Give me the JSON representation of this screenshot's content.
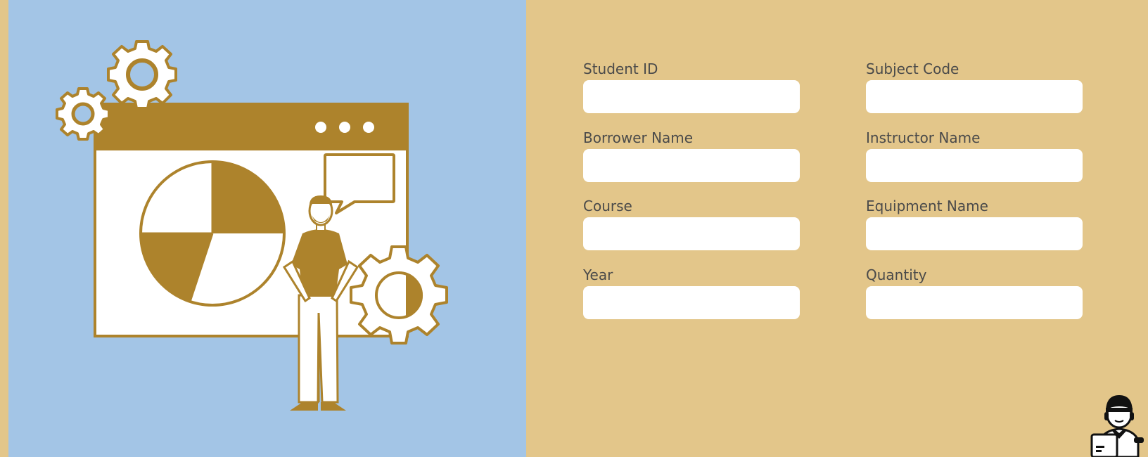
{
  "colors": {
    "page_background": "#E3C68A",
    "left_panel": "#A3C5E6",
    "illustration_accent": "#AD832C",
    "input_background": "#FFFFFF",
    "label_text": "#4A4A4A"
  },
  "form": {
    "fields": [
      {
        "label": "Student ID",
        "value": ""
      },
      {
        "label": "Subject Code",
        "value": ""
      },
      {
        "label": "Borrower Name",
        "value": ""
      },
      {
        "label": "Instructor Name",
        "value": ""
      },
      {
        "label": "Course",
        "value": ""
      },
      {
        "label": "Equipment Name",
        "value": ""
      },
      {
        "label": "Year",
        "value": ""
      },
      {
        "label": "Quantity",
        "value": ""
      }
    ]
  },
  "illustration": {
    "icons": [
      "gear-icon",
      "browser-window-icon",
      "pie-chart-icon",
      "speech-bubble-icon",
      "person-icon"
    ]
  },
  "assistant": {
    "icon": "delivery-agent-icon"
  }
}
